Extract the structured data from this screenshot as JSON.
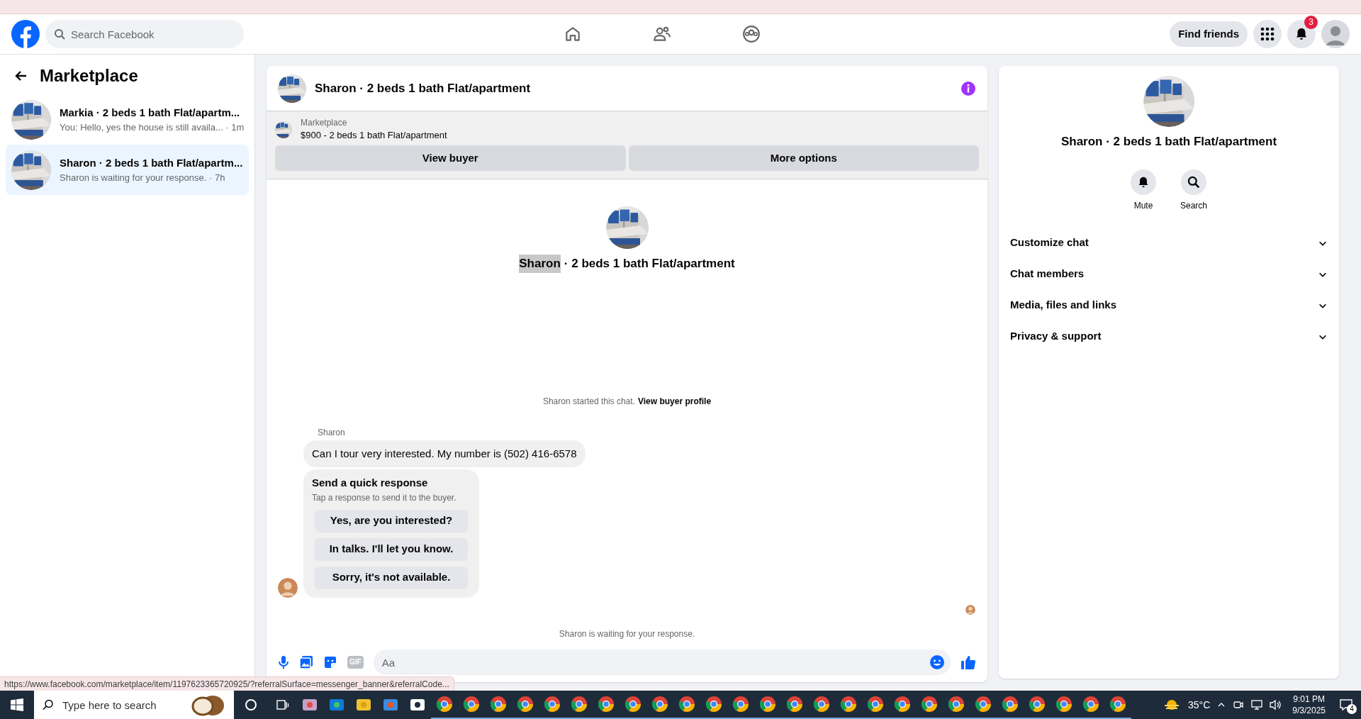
{
  "topbar": {
    "search": {
      "placeholder": "Search Facebook"
    },
    "find_friends": "Find friends",
    "notifications_badge": "3"
  },
  "sidebar": {
    "title": "Marketplace",
    "conversations": [
      {
        "title": "Markia · 2 beds 1 bath Flat/apartm...",
        "preview": "You: Hello, yes the house is still availa... · 1m",
        "selected": false
      },
      {
        "title": "Sharon · 2 beds 1 bath Flat/apartm...",
        "preview": "Sharon is waiting for your response. · 7h",
        "selected": true
      }
    ]
  },
  "chat": {
    "title": "Sharon · 2 beds 1 bath Flat/apartment",
    "banner": {
      "label": "Marketplace",
      "listing": "$900 - 2 beds 1 bath Flat/apartment",
      "buttons": [
        "View buyer",
        "More options"
      ]
    },
    "intro": {
      "name": "Sharon",
      "name_highlighted": true,
      "rest": "· 2 beds 1 bath Flat/apartment"
    },
    "started": "Sharon started this chat.",
    "started_link": "View buyer profile",
    "sender": "Sharon",
    "message": "Can I tour very interested. My number is (502) 416-6578",
    "quick_response": {
      "title": "Send a quick response",
      "subtitle": "Tap a response to send it to the buyer.",
      "options": [
        "Yes, are you interested?",
        "In talks. I'll let you know.",
        "Sorry, it's not available."
      ]
    },
    "waiting": "Sharon is waiting for your response.",
    "composer": {
      "placeholder": "Aa",
      "gif_label": "GIF"
    }
  },
  "details": {
    "title": "Sharon · 2 beds 1 bath Flat/apartment",
    "actions": [
      {
        "kind": "mute",
        "label": "Mute"
      },
      {
        "kind": "search",
        "label": "Search"
      }
    ],
    "sections": [
      {
        "label": "Customize chat",
        "expanded": false
      },
      {
        "label": "Chat members",
        "expanded": false
      },
      {
        "label": "Media, files and links",
        "expanded": false
      },
      {
        "label": "Privacy & support",
        "expanded": false
      }
    ]
  },
  "status_url": "https://www.facebook.com/marketplace/item/1197623365720925/?referralSurface=messenger_banner&referralCode...",
  "taskbar": {
    "search_placeholder": "Type here to search",
    "weather": "35°C",
    "time": "9:01 PM",
    "date": "9/3/2025",
    "notifications": "4"
  }
}
